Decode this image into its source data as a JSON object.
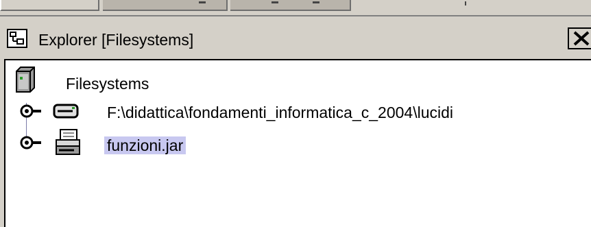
{
  "panel": {
    "title": "Explorer [Filesystems]",
    "close_glyph": "✕",
    "icons": {
      "title": "explorer-icon",
      "close": "close-icon"
    }
  },
  "tree": {
    "root": {
      "label": "Filesystems",
      "icon": "filesystems-icon"
    },
    "items": [
      {
        "label": "F:\\didattica\\fondamenti_informatica_c_2004\\lucidi",
        "icon": "local-disk-icon",
        "selected": false
      },
      {
        "label": "funzioni.jar",
        "icon": "jar-archive-icon",
        "selected": true
      }
    ]
  },
  "colors": {
    "background": "#d4d0c8",
    "selection": "#c8c8f0",
    "tree_bg": "#ffffff"
  }
}
